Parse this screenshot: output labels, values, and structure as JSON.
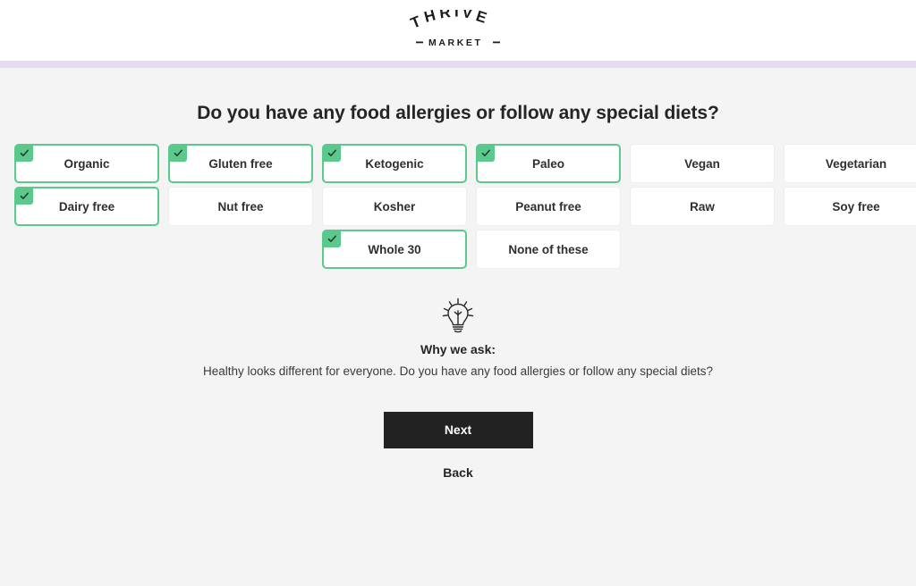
{
  "header": {
    "logo_top": "THRIVE",
    "logo_bottom": "MARKET",
    "logo_name": "thrive-market-logo"
  },
  "progress": {
    "accent_color": "#e6dcf1",
    "percent": 100
  },
  "main": {
    "title": "Do you have any food allergies or follow any special diets?",
    "selected_color": "#5bc98c",
    "options": [
      {
        "label": "Organic",
        "selected": true,
        "col": 1
      },
      {
        "label": "Gluten free",
        "selected": true,
        "col": 2
      },
      {
        "label": "Ketogenic",
        "selected": true,
        "col": 3
      },
      {
        "label": "Paleo",
        "selected": true,
        "col": 4
      },
      {
        "label": "Vegan",
        "selected": false,
        "col": 5
      },
      {
        "label": "Vegetarian",
        "selected": false,
        "col": 6
      },
      {
        "label": "Dairy free",
        "selected": true,
        "col": 1
      },
      {
        "label": "Nut free",
        "selected": false,
        "col": 2
      },
      {
        "label": "Kosher",
        "selected": false,
        "col": 3
      },
      {
        "label": "Peanut free",
        "selected": false,
        "col": 4
      },
      {
        "label": "Raw",
        "selected": false,
        "col": 5
      },
      {
        "label": "Soy free",
        "selected": false,
        "col": 6
      },
      {
        "label": "Whole 30",
        "selected": true,
        "col": 3
      },
      {
        "label": "None of these",
        "selected": false,
        "col": 4
      }
    ]
  },
  "why": {
    "icon": "lightbulb-icon",
    "heading": "Why we ask:",
    "body": "Healthy looks different for everyone. Do you have any food allergies or follow any special diets?"
  },
  "actions": {
    "next_label": "Next",
    "back_label": "Back"
  }
}
